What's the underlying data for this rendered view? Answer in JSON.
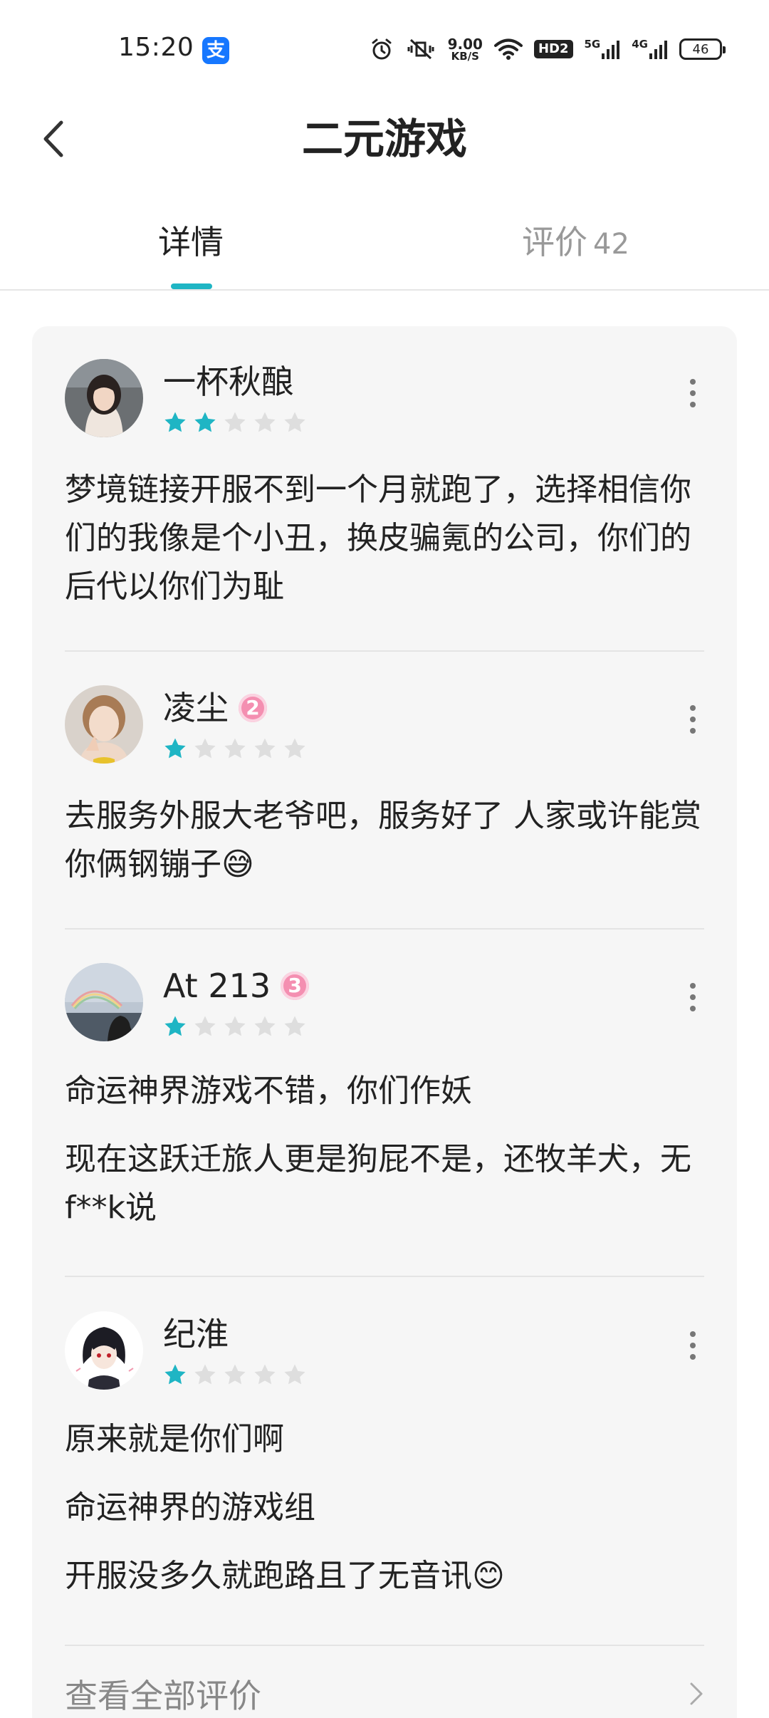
{
  "status_bar": {
    "time": "15:20",
    "alipay_icon_text": "支",
    "net_speed_value": "9.00",
    "net_speed_unit": "KB/S",
    "hd_label": "HD2",
    "sig1_label": "5G",
    "sig2_label": "4G",
    "battery": "46"
  },
  "header": {
    "title": "二元游戏"
  },
  "tabs": {
    "details_label": "详情",
    "reviews_label": "评价",
    "reviews_count": "42",
    "accent_color": "#1fb5c4"
  },
  "reviews": [
    {
      "name": "一杯秋酿",
      "level": "",
      "rating": 2,
      "paragraphs": [
        "梦境链接开服不到一个月就跑了，选择相信你们的我像是个小丑，换皮骗氪的公司，你们的后代以你们为耻"
      ]
    },
    {
      "name": "凌尘",
      "level": "2",
      "rating": 1,
      "paragraphs": [
        "去服务外服大老爷吧，服务好了 人家或许能赏你俩钢镚子😅"
      ]
    },
    {
      "name": "At 213",
      "level": "3",
      "rating": 1,
      "paragraphs": [
        "命运神界游戏不错，你们作妖",
        "现在这跃迁旅人更是狗屁不是，还牧羊犬，无f**k说"
      ]
    },
    {
      "name": "纪淮",
      "level": "",
      "rating": 1,
      "paragraphs": [
        "原来就是你们啊",
        "命运神界的游戏组",
        "开服没多久就跑路且了无音讯😊"
      ]
    }
  ],
  "footer": {
    "view_all_label": "查看全部评价"
  },
  "icons": {
    "back": "chevron-left-icon",
    "more": "more-vertical-icon",
    "star": "star-icon",
    "view_all": "chevron-right-icon"
  },
  "colors": {
    "star_filled": "#1fb5c4",
    "star_empty": "#dedede",
    "level_badge": "#f48fb1"
  }
}
